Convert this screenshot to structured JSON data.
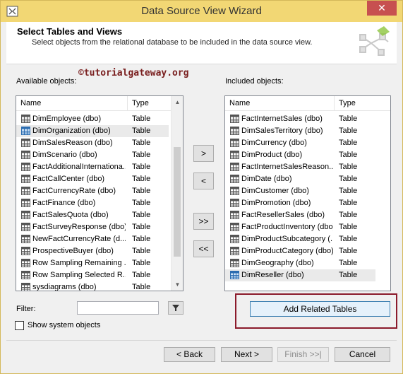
{
  "window": {
    "title": "Data Source View Wizard",
    "close_label": "✕"
  },
  "header": {
    "title": "Select Tables and Views",
    "subtitle": "Select objects from the relational database to be included in the data source view."
  },
  "watermark": "©tutorialgateway.org",
  "available": {
    "label": "Available objects:",
    "col_name": "Name",
    "col_type": "Type",
    "rows": [
      {
        "name": "DimEmployee (dbo)",
        "type": "Table",
        "icon": "table-icon"
      },
      {
        "name": "DimOrganization (dbo)",
        "type": "Table",
        "icon": "table-icon-blue",
        "selected": true
      },
      {
        "name": "DimSalesReason (dbo)",
        "type": "Table",
        "icon": "table-icon"
      },
      {
        "name": "DimScenario (dbo)",
        "type": "Table",
        "icon": "table-icon"
      },
      {
        "name": "FactAdditionalInternationa...",
        "type": "Table",
        "icon": "table-icon"
      },
      {
        "name": "FactCallCenter (dbo)",
        "type": "Table",
        "icon": "table-icon"
      },
      {
        "name": "FactCurrencyRate (dbo)",
        "type": "Table",
        "icon": "table-icon"
      },
      {
        "name": "FactFinance (dbo)",
        "type": "Table",
        "icon": "table-icon"
      },
      {
        "name": "FactSalesQuota (dbo)",
        "type": "Table",
        "icon": "table-icon"
      },
      {
        "name": "FactSurveyResponse (dbo)",
        "type": "Table",
        "icon": "table-icon"
      },
      {
        "name": "NewFactCurrencyRate (d...",
        "type": "Table",
        "icon": "table-icon"
      },
      {
        "name": "ProspectiveBuyer (dbo)",
        "type": "Table",
        "icon": "table-icon"
      },
      {
        "name": "Row Sampling Remaining ...",
        "type": "Table",
        "icon": "table-icon"
      },
      {
        "name": "Row Sampling Selected R...",
        "type": "Table",
        "icon": "table-icon"
      },
      {
        "name": "sysdiagrams (dbo)",
        "type": "Table",
        "icon": "table-icon"
      }
    ]
  },
  "included": {
    "label": "Included objects:",
    "col_name": "Name",
    "col_type": "Type",
    "rows": [
      {
        "name": "FactInternetSales (dbo)",
        "type": "Table",
        "icon": "table-icon"
      },
      {
        "name": "DimSalesTerritory (dbo)",
        "type": "Table",
        "icon": "table-icon"
      },
      {
        "name": "DimCurrency (dbo)",
        "type": "Table",
        "icon": "table-icon"
      },
      {
        "name": "DimProduct (dbo)",
        "type": "Table",
        "icon": "table-icon"
      },
      {
        "name": "FactInternetSalesReason...",
        "type": "Table",
        "icon": "table-icon"
      },
      {
        "name": "DimDate (dbo)",
        "type": "Table",
        "icon": "table-icon"
      },
      {
        "name": "DimCustomer (dbo)",
        "type": "Table",
        "icon": "table-icon"
      },
      {
        "name": "DimPromotion (dbo)",
        "type": "Table",
        "icon": "table-icon"
      },
      {
        "name": "FactResellerSales (dbo)",
        "type": "Table",
        "icon": "table-icon"
      },
      {
        "name": "FactProductInventory (dbo)",
        "type": "Table",
        "icon": "table-icon"
      },
      {
        "name": "DimProductSubcategory (...",
        "type": "Table",
        "icon": "table-icon"
      },
      {
        "name": "DimProductCategory (dbo)",
        "type": "Table",
        "icon": "table-icon"
      },
      {
        "name": "DimGeography (dbo)",
        "type": "Table",
        "icon": "table-icon"
      },
      {
        "name": "DimReseller (dbo)",
        "type": "Table",
        "icon": "table-icon-blue",
        "selected": true
      }
    ]
  },
  "move_buttons": {
    "add": ">",
    "remove": "<",
    "add_all": ">>",
    "remove_all": "<<"
  },
  "add_related_label": "Add Related Tables",
  "filter": {
    "label": "Filter:",
    "value": "",
    "button_icon": "filter-funnel-icon"
  },
  "show_system": {
    "label": "Show system objects",
    "checked": false
  },
  "footer": {
    "back": "< Back",
    "next": "Next >",
    "finish": "Finish >>|",
    "cancel": "Cancel"
  }
}
